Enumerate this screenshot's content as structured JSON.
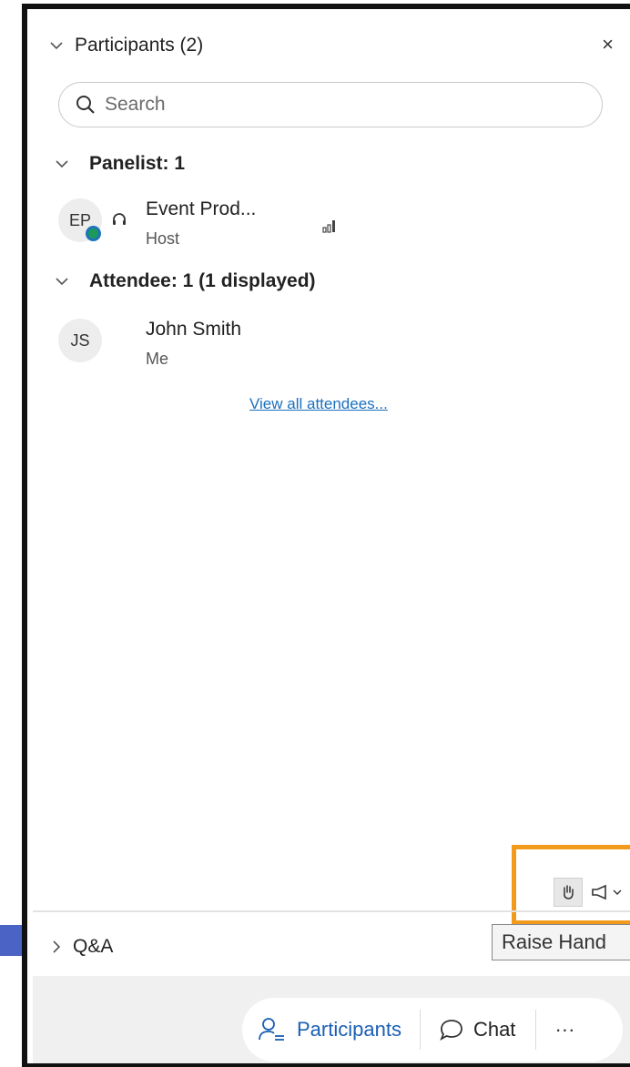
{
  "panel": {
    "title": "Participants (2)",
    "close_symbol": "×"
  },
  "search": {
    "placeholder": "Search"
  },
  "panelist_section": {
    "header": "Panelist: 1",
    "members": [
      {
        "initials": "EP",
        "name": "Event Prod...",
        "role": "Host"
      }
    ]
  },
  "attendee_section": {
    "header": "Attendee: 1 (1 displayed)",
    "members": [
      {
        "initials": "JS",
        "name": "John Smith",
        "role": "Me"
      }
    ],
    "view_all_link": "View all attendees..."
  },
  "qa_section": {
    "label": "Q&A"
  },
  "tooltip": {
    "text": "Raise Hand"
  },
  "footer": {
    "participants_label": "Participants",
    "chat_label": "Chat",
    "more_symbol": "···"
  },
  "colors": {
    "highlight": "#f29a1c",
    "link": "#1a6fbf",
    "accent": "#1d74b9",
    "presence": "#1c9a5a"
  },
  "icons": [
    "chevron-down-icon",
    "close-icon",
    "search-icon",
    "headset-icon",
    "signal-bars-icon",
    "chevron-right-icon",
    "raise-hand-icon",
    "megaphone-icon",
    "participants-icon",
    "chat-icon",
    "more-icon"
  ]
}
